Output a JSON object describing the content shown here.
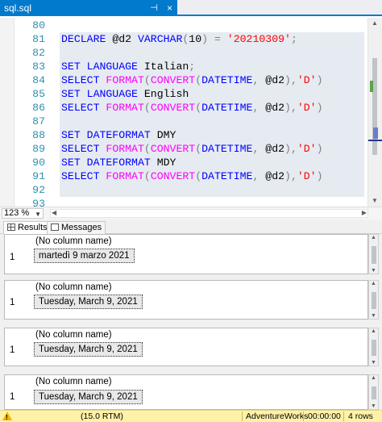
{
  "tab": {
    "title": "sql.sql",
    "pin": "⊣",
    "close": "×"
  },
  "editor": {
    "lines": [
      {
        "n": "80",
        "tokens": []
      },
      {
        "n": "81",
        "tokens": [
          {
            "t": "DECLARE ",
            "c": "kw"
          },
          {
            "t": "@d2 ",
            "c": "plain"
          },
          {
            "t": "VARCHAR",
            "c": "kw"
          },
          {
            "t": "(",
            "c": "gray"
          },
          {
            "t": "10",
            "c": "plain"
          },
          {
            "t": ")",
            "c": "gray"
          },
          {
            "t": " = ",
            "c": "gray"
          },
          {
            "t": "'20210309'",
            "c": "str"
          },
          {
            "t": ";",
            "c": "gray"
          }
        ]
      },
      {
        "n": "82",
        "tokens": []
      },
      {
        "n": "83",
        "tokens": [
          {
            "t": "SET LANGUAGE ",
            "c": "kw"
          },
          {
            "t": "Italian",
            "c": "plain"
          },
          {
            "t": ";",
            "c": "gray"
          }
        ]
      },
      {
        "n": "84",
        "tokens": [
          {
            "t": "SELECT ",
            "c": "kw"
          },
          {
            "t": "FORMAT",
            "c": "fn"
          },
          {
            "t": "(",
            "c": "gray"
          },
          {
            "t": "CONVERT",
            "c": "fn"
          },
          {
            "t": "(",
            "c": "gray"
          },
          {
            "t": "DATETIME",
            "c": "kw"
          },
          {
            "t": ", ",
            "c": "gray"
          },
          {
            "t": "@d2",
            "c": "plain"
          },
          {
            "t": "),",
            "c": "gray"
          },
          {
            "t": "'D'",
            "c": "str"
          },
          {
            "t": ")",
            "c": "gray"
          }
        ]
      },
      {
        "n": "85",
        "tokens": [
          {
            "t": "SET LANGUAGE ",
            "c": "kw"
          },
          {
            "t": "English",
            "c": "plain"
          }
        ]
      },
      {
        "n": "86",
        "tokens": [
          {
            "t": "SELECT ",
            "c": "kw"
          },
          {
            "t": "FORMAT",
            "c": "fn"
          },
          {
            "t": "(",
            "c": "gray"
          },
          {
            "t": "CONVERT",
            "c": "fn"
          },
          {
            "t": "(",
            "c": "gray"
          },
          {
            "t": "DATETIME",
            "c": "kw"
          },
          {
            "t": ", ",
            "c": "gray"
          },
          {
            "t": "@d2",
            "c": "plain"
          },
          {
            "t": "),",
            "c": "gray"
          },
          {
            "t": "'D'",
            "c": "str"
          },
          {
            "t": ")",
            "c": "gray"
          }
        ]
      },
      {
        "n": "87",
        "tokens": []
      },
      {
        "n": "88",
        "tokens": [
          {
            "t": "SET DATEFORMAT ",
            "c": "kw"
          },
          {
            "t": "DMY",
            "c": "plain"
          }
        ]
      },
      {
        "n": "89",
        "tokens": [
          {
            "t": "SELECT ",
            "c": "kw"
          },
          {
            "t": "FORMAT",
            "c": "fn"
          },
          {
            "t": "(",
            "c": "gray"
          },
          {
            "t": "CONVERT",
            "c": "fn"
          },
          {
            "t": "(",
            "c": "gray"
          },
          {
            "t": "DATETIME",
            "c": "kw"
          },
          {
            "t": ", ",
            "c": "gray"
          },
          {
            "t": "@d2",
            "c": "plain"
          },
          {
            "t": "),",
            "c": "gray"
          },
          {
            "t": "'D'",
            "c": "str"
          },
          {
            "t": ")",
            "c": "gray"
          }
        ]
      },
      {
        "n": "90",
        "tokens": [
          {
            "t": "SET DATEFORMAT ",
            "c": "kw"
          },
          {
            "t": "MDY",
            "c": "plain"
          }
        ]
      },
      {
        "n": "91",
        "tokens": [
          {
            "t": "SELECT ",
            "c": "kw"
          },
          {
            "t": "FORMAT",
            "c": "fn"
          },
          {
            "t": "(",
            "c": "gray"
          },
          {
            "t": "CONVERT",
            "c": "fn"
          },
          {
            "t": "(",
            "c": "gray"
          },
          {
            "t": "DATETIME",
            "c": "kw"
          },
          {
            "t": ", ",
            "c": "gray"
          },
          {
            "t": "@d2",
            "c": "plain"
          },
          {
            "t": "),",
            "c": "gray"
          },
          {
            "t": "'D'",
            "c": "str"
          },
          {
            "t": ")",
            "c": "gray"
          }
        ]
      },
      {
        "n": "92",
        "tokens": []
      },
      {
        "n": "93",
        "tokens": []
      }
    ]
  },
  "zoom": {
    "value": "123 %"
  },
  "result_tabs": {
    "results": "Results",
    "messages": "Messages"
  },
  "grids": [
    {
      "header": "(No column name)",
      "row": "1",
      "value": "martedì 9 marzo 2021"
    },
    {
      "header": "(No column name)",
      "row": "1",
      "value": "Tuesday, March 9, 2021"
    },
    {
      "header": "(No column name)",
      "row": "1",
      "value": "Tuesday, March 9, 2021"
    },
    {
      "header": "(No column name)",
      "row": "1",
      "value": "Tuesday, March 9, 2021"
    }
  ],
  "status": {
    "version": "(15.0 RTM)",
    "database": "AdventureWorks",
    "time": "00:00:00",
    "rows": "4 rows"
  },
  "colors": {
    "accent": "#007acc",
    "keyword": "#0000ff",
    "function": "#ff00ff",
    "string": "#ff0000",
    "line_number": "#2b91af",
    "status_bar": "#fff2a8"
  }
}
